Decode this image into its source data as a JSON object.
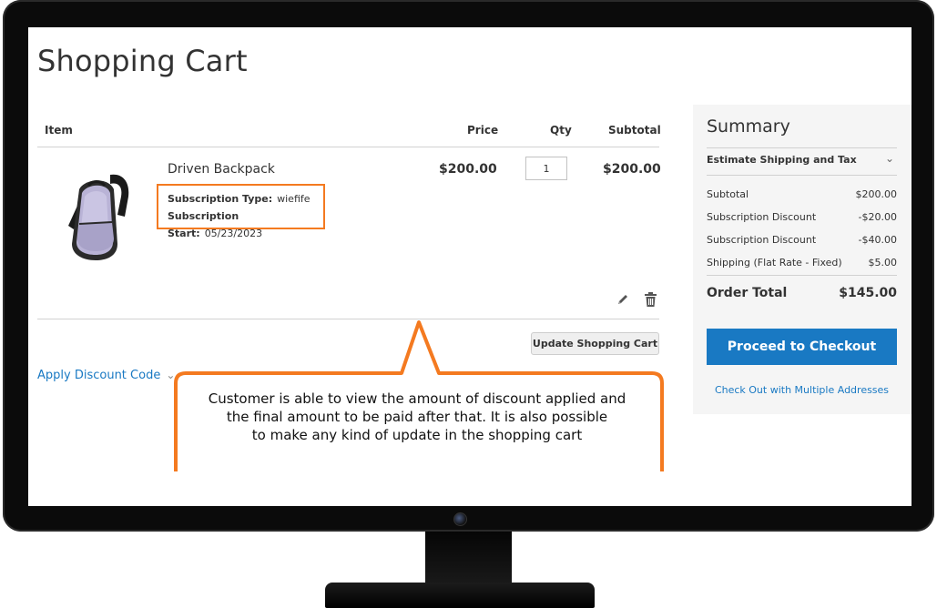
{
  "page": {
    "title": "Shopping Cart"
  },
  "cart": {
    "columns": {
      "item": "Item",
      "price": "Price",
      "qty": "Qty",
      "subtotal": "Subtotal"
    },
    "product": {
      "name": "Driven Backpack",
      "options": [
        {
          "label": "Subscription Type:",
          "value": "wiefife"
        },
        {
          "label": "Subscription Start:",
          "value": "05/23/2023"
        }
      ],
      "price": "$200.00",
      "qty": "1",
      "subtotal": "$200.00",
      "image_icon": "backpack-image"
    },
    "update_button": "Update Shopping Cart",
    "discount_toggle": "Apply Discount Code",
    "edit_icon": "pencil-icon",
    "delete_icon": "trash-icon"
  },
  "summary": {
    "title": "Summary",
    "estimate_label": "Estimate Shipping and Tax",
    "rows": [
      {
        "label": "Subtotal",
        "amount": "$200.00"
      },
      {
        "label": "Subscription Discount",
        "amount": "-$20.00"
      },
      {
        "label": "Subscription Discount",
        "amount": "-$40.00"
      },
      {
        "label": "Shipping (Flat Rate - Fixed)",
        "amount": "$5.00"
      }
    ],
    "order_total_label": "Order Total",
    "order_total_amount": "$145.00",
    "checkout_button": "Proceed to Checkout",
    "multi_address_link": "Check Out with Multiple Addresses"
  },
  "callout": {
    "lines": [
      "Customer is able to view the amount of discount applied and",
      "the final amount to be paid after that. It is also possible",
      "to make any kind of update in the shopping cart"
    ]
  },
  "colors": {
    "accent": "#1979c3",
    "callout_border": "#f47a20",
    "option_border": "#f47a20",
    "summary_bg": "#f5f5f5"
  }
}
